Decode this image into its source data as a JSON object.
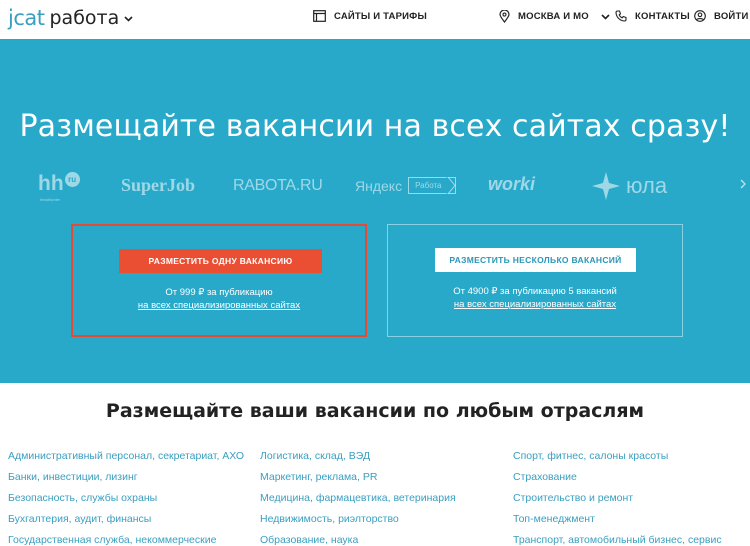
{
  "header": {
    "logo_jcat": "jcat",
    "logo_rabota": "работа",
    "plans": "САЙТЫ И ТАРИФЫ",
    "city": "МОСКВА И МО",
    "contacts": "КОНТАКТЫ",
    "login": "ВОЙТИ"
  },
  "hero": {
    "title": "Размещайте вакансии на всех сайтах сразу!",
    "brands": {
      "hh": "hh",
      "hh_ru": "ru",
      "hh_sub": "headhunter",
      "superjob": "SuperJob",
      "rabota": "RABOTA.RU",
      "yandex": "Яндекс",
      "yandex_tag": "Работа",
      "worki": "worki",
      "yula": "юла"
    },
    "left_box": {
      "button": "РАЗМЕСТИТЬ ОДНУ ВАКАНСИЮ",
      "price": "От 999 ₽ за публикацию",
      "link": "на всех специализированных сайтах"
    },
    "right_box": {
      "button": "РАЗМЕСТИТЬ НЕСКОЛЬКО ВАКАНСИЙ",
      "price": "От 4900 ₽ за публикацию 5 вакансий",
      "link": "на всех специализированных сайтах"
    }
  },
  "industries": {
    "title": "Размещайте ваши вакансии по любым отраслям",
    "col1": [
      "Административный персонал, секретариат, АХО",
      "Банки, инвестиции, лизинг",
      "Безопасность, службы охраны",
      "Бухгалтерия, аудит, финансы",
      "Государственная служба, некоммерческие"
    ],
    "col2": [
      "Логистика, склад, ВЭД",
      "Маркетинг, реклама, PR",
      "Медицина, фармацевтика, ветеринария",
      "Недвижимость, риэлторство",
      "Образование, наука"
    ],
    "col3": [
      "Спорт, фитнес, салоны красоты",
      "Страхование",
      "Строительство и ремонт",
      "Топ-менеджмент",
      "Транспорт, автомобильный бизнес, сервис"
    ]
  },
  "colors": {
    "hero_bg": "#28a9ca",
    "accent_red": "#ea4f33",
    "link_blue": "#3a9fc0"
  }
}
